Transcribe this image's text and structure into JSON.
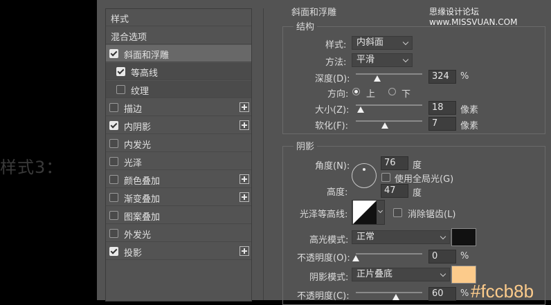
{
  "caption": "样式3：",
  "watermark": "思缘设计论坛 www.MISSVUAN.COM",
  "color_note": "#fccb8b",
  "styles_list": {
    "header": "样式",
    "blend": "混合选项",
    "items": [
      {
        "label": "斜面和浮雕",
        "checked": true,
        "selected": true
      },
      {
        "label": "等高线",
        "checked": true,
        "sub": true
      },
      {
        "label": "纹理",
        "checked": false,
        "sub": true
      },
      {
        "label": "描边",
        "checked": false,
        "plus": true
      },
      {
        "label": "内阴影",
        "checked": true,
        "plus": true
      },
      {
        "label": "内发光",
        "checked": false
      },
      {
        "label": "光泽",
        "checked": false
      },
      {
        "label": "颜色叠加",
        "checked": false,
        "plus": true
      },
      {
        "label": "渐变叠加",
        "checked": false,
        "plus": true
      },
      {
        "label": "图案叠加",
        "checked": false
      },
      {
        "label": "外发光",
        "checked": false
      },
      {
        "label": "投影",
        "checked": true,
        "plus": true
      }
    ]
  },
  "bevel": {
    "title": "斜面和浮雕",
    "structure": {
      "title": "结构",
      "style_label": "样式:",
      "style_value": "内斜面",
      "method_label": "方法:",
      "method_value": "平滑",
      "depth_label": "深度(D):",
      "depth_value": "324",
      "depth_unit": "%",
      "depth_fraction": 0.32,
      "direction_label": "方向:",
      "dir_up": "上",
      "dir_down": "下",
      "size_label": "大小(Z):",
      "size_value": "18",
      "size_unit": "像素",
      "size_fraction": 0.07,
      "soften_label": "软化(F):",
      "soften_value": "7",
      "soften_unit": "像素",
      "soften_fraction": 0.44
    },
    "shading": {
      "title": "阴影",
      "angle_label": "角度(N):",
      "angle_value": "76",
      "angle_unit": "度",
      "global_light": "使用全局光(G)",
      "altitude_label": "高度:",
      "altitude_value": "47",
      "altitude_unit": "度",
      "gloss_label": "光泽等高线:",
      "antialias": "消除锯齿(L)",
      "highlight_label": "高光模式:",
      "highlight_mode": "正常",
      "highlight_color": "#111111",
      "opacity1_label": "不透明度(O):",
      "opacity1_value": "0",
      "opacity1_unit": "%",
      "opacity1_fraction": 0.0,
      "shadow_label": "阴影模式:",
      "shadow_mode": "正片叠底",
      "shadow_color": "#fccb8b",
      "opacity2_label": "不透明度(C):",
      "opacity2_value": "60",
      "opacity2_unit": "%",
      "opacity2_fraction": 0.6
    }
  }
}
